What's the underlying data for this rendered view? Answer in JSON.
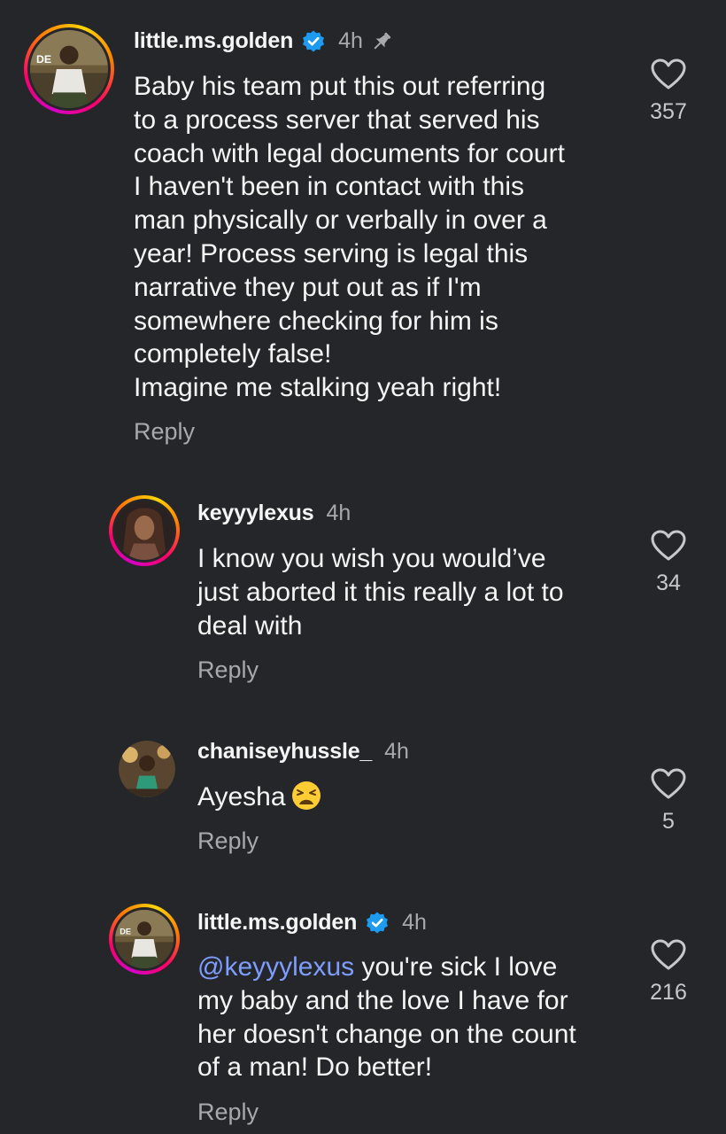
{
  "comments": [
    {
      "username": "little.ms.golden",
      "verified": true,
      "time": "4h",
      "pinned": true,
      "text": "Baby his team put this out referring\nto a process server that served his\ncoach with legal documents for court\nI haven't been in contact with this\nman physically or verbally in over a\nyear! Process serving is legal this\nnarrative they put out as if I'm\nsomewhere checking for him is\ncompletely false!\nImagine me stalking yeah right!",
      "reply_label": "Reply",
      "likes": "357"
    },
    {
      "username": "keyyylexus",
      "verified": false,
      "time": "4h",
      "text": "I know you wish you would’ve\njust aborted it this really a lot to\ndeal with",
      "reply_label": "Reply",
      "likes": "34"
    },
    {
      "username": "chaniseyhussle_",
      "verified": false,
      "time": "4h",
      "text": "Ayesha",
      "emoji": "weary-face-emoji",
      "reply_label": "Reply",
      "likes": "5"
    },
    {
      "username": "little.ms.golden",
      "verified": true,
      "time": "4h",
      "mention": "@keyyylexus",
      "text": " you're sick I love\nmy baby and the love I have for\nher doesn't change on the count\nof a man! Do better!",
      "reply_label": "Reply",
      "likes": "216"
    }
  ],
  "colors": {
    "background": "#25262a",
    "text": "#f5f5f5",
    "secondary": "#a8a8ad",
    "mention": "#7d9eff",
    "verified": "#1d9bf0"
  },
  "icons": [
    "verified-badge-icon",
    "pin-icon",
    "heart-icon",
    "weary-face-emoji"
  ]
}
